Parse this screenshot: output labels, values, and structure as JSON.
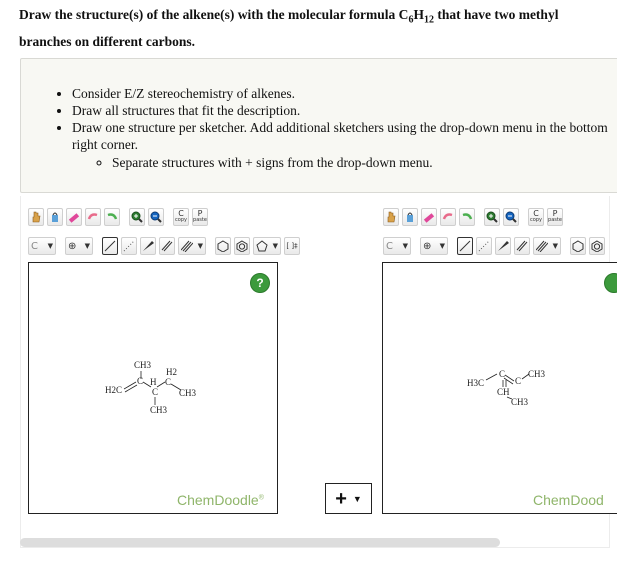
{
  "question": {
    "line1_prefix": "Draw the structure(s) of the alkene(s) with the molecular formula C",
    "c_count": "6",
    "h_mid": "H",
    "h_count": "12",
    "line1_suffix": " that have two methyl",
    "line2": "branches on different carbons."
  },
  "instructions": {
    "items": [
      "Consider E/Z stereochemistry of alkenes.",
      "Draw all structures that fit the description.",
      "Draw one structure per sketcher. Add additional sketchers using the drop-down menu in the bottom right corner."
    ],
    "subitems": [
      "Separate structures with + signs from the drop-down menu."
    ]
  },
  "toolbar": {
    "copy_label": "C",
    "copy_sub": "copy",
    "paste_label": "P",
    "paste_sub": "paste",
    "element_label": "C",
    "charge_label": "⊕",
    "bracket_label": "[ ]‡"
  },
  "sketcher1": {
    "brand": "ChemDoodle",
    "brand_mark": "®",
    "help": "?",
    "labels": {
      "ch3_top": "CH3",
      "h2": "H2",
      "h3c": "H2C",
      "c1": "C",
      "h": "H",
      "c2": "C",
      "ch3_right": "CH3",
      "c3": "C",
      "ch3_bottom": "CH3"
    }
  },
  "sketcher2": {
    "brand": "ChemDood",
    "labels": {
      "h3c": "H3C",
      "c1": "C",
      "c2": "C",
      "ch3_right": "CH3",
      "ch": "CH",
      "ch3_bottom": "CH3"
    }
  },
  "add_sketcher": {
    "plus": "+",
    "caret": "▼"
  }
}
